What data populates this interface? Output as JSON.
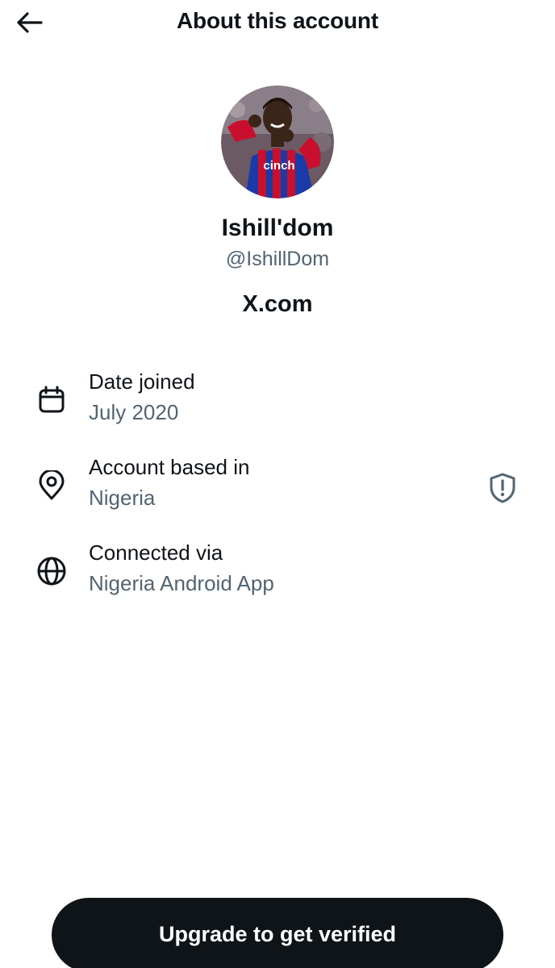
{
  "header": {
    "title": "About this account",
    "back_icon": "arrow-left-icon"
  },
  "profile": {
    "display_name": "Ishill'dom",
    "handle": "@IshillDom",
    "avatar_icon": "profile-photo",
    "avatar_jersey_text": "cinch",
    "site": "X.com"
  },
  "details": [
    {
      "icon": "calendar-icon",
      "label": "Date joined",
      "value": "July 2020"
    },
    {
      "icon": "location-pin-icon",
      "label": "Account based in",
      "value": "Nigeria",
      "badge_icon": "shield-alert-icon"
    },
    {
      "icon": "globe-icon",
      "label": "Connected via",
      "value": "Nigeria Android App"
    }
  ],
  "footer": {
    "upgrade_label": "Upgrade to get verified"
  },
  "colors": {
    "primary_text": "#0f1419",
    "secondary_text": "#536471",
    "button_bg": "#0f1419",
    "button_text": "#ffffff",
    "background": "#ffffff"
  }
}
